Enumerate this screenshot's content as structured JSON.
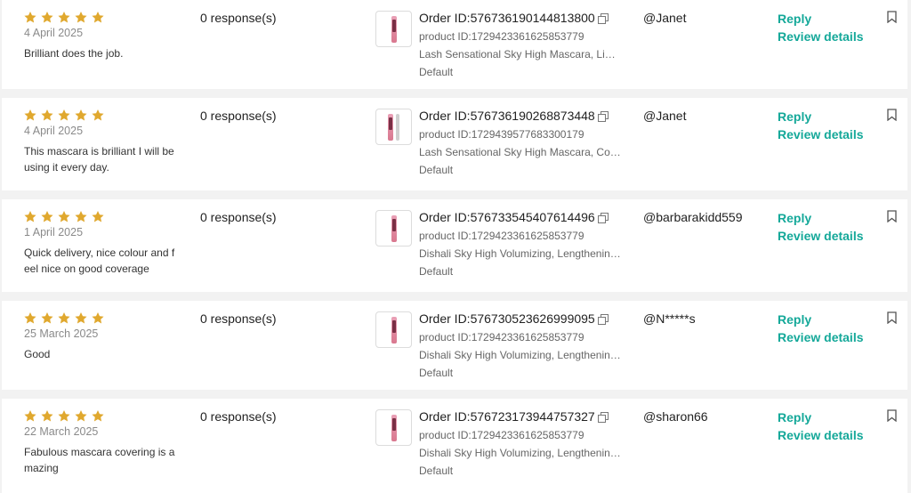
{
  "colors": {
    "accent": "#14a899",
    "star": "#e0a82e"
  },
  "icons": {
    "star": "star-icon",
    "copy": "copy-icon",
    "bookmark": "bookmark-icon"
  },
  "reviews": [
    {
      "rating": 5,
      "date": "4 April 2025",
      "comment": "Brilliant does the job.",
      "responses": "0 response(s)",
      "order_id": "Order ID:576736190144813800",
      "product_id": "product ID:1729423361625853779",
      "product_name": "Lash Sensational Sky High Mascara, Limited Edition",
      "variant": "Default",
      "user": "@Janet",
      "reply_label": "Reply",
      "details_label": "Review details"
    },
    {
      "rating": 5,
      "date": "4 April 2025",
      "comment": "This mascara is brilliant I will be\nusing it every day.",
      "responses": "0 response(s)",
      "order_id": "Order ID:576736190268873448",
      "product_id": "product ID:1729439577683300179",
      "product_name": "Lash Sensational Sky High Mascara, Cosmic Black",
      "variant": "Default",
      "user": "@Janet",
      "reply_label": "Reply",
      "details_label": "Review details"
    },
    {
      "rating": 5,
      "date": "1 April 2025",
      "comment": "Quick delivery, nice colour and f\neel nice on good coverage",
      "responses": "0 response(s)",
      "order_id": "Order ID:576733545407614496",
      "product_id": "product ID:1729423361625853779",
      "product_name": "Dishali Sky High Volumizing, Lengthening Mascara",
      "variant": "Default",
      "user": "@barbarakidd559",
      "reply_label": "Reply",
      "details_label": "Review details"
    },
    {
      "rating": 5,
      "date": "25 March 2025",
      "comment": "Good",
      "responses": "0 response(s)",
      "order_id": "Order ID:576730523626999095",
      "product_id": "product ID:1729423361625853779",
      "product_name": "Dishali Sky High Volumizing, Lengthening Mascara",
      "variant": "Default",
      "user": "@N*****s",
      "reply_label": "Reply",
      "details_label": "Review details"
    },
    {
      "rating": 5,
      "date": "22 March 2025",
      "comment": "Fabulous mascara covering is a\nmazing",
      "responses": "0 response(s)",
      "order_id": "Order ID:576723173944757327",
      "product_id": "product ID:1729423361625853779",
      "product_name": "Dishali Sky High Volumizing, Lengthening Mascara",
      "variant": "Default",
      "user": "@sharon66",
      "reply_label": "Reply",
      "details_label": "Review details"
    }
  ]
}
